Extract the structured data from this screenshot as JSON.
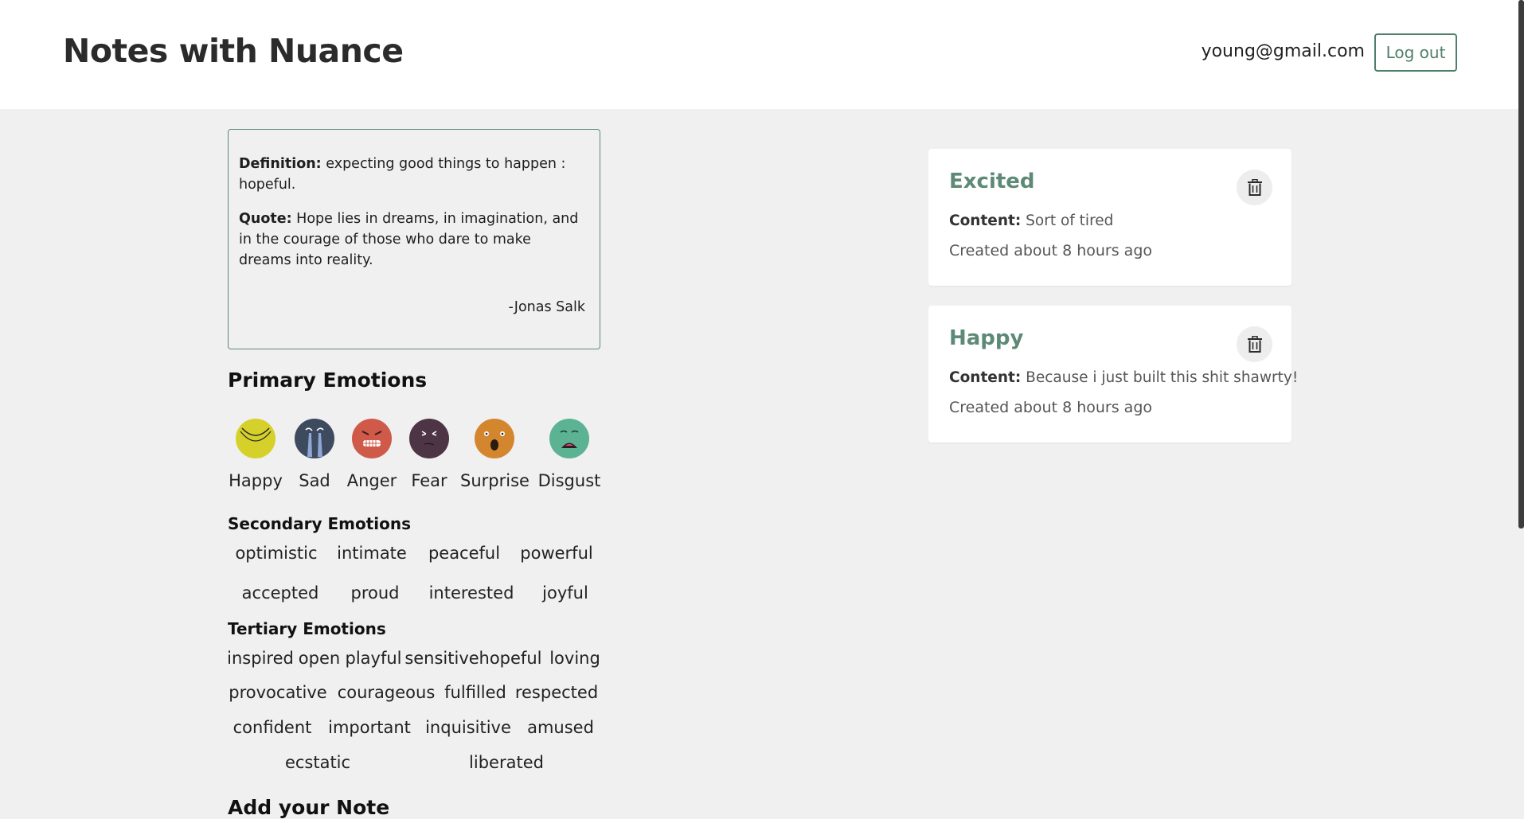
{
  "header": {
    "title": "Notes with Nuance",
    "user_email": "young@gmail.com",
    "logout_label": "Log out"
  },
  "quote_card": {
    "definition_label": "Definition:",
    "definition_text": "expecting good things to happen : hopeful.",
    "quote_label": "Quote:",
    "quote_text": "Hope lies in dreams, in imagination, and in the courage of those who dare to make dreams into reality.",
    "author": "-Jonas Salk"
  },
  "primary": {
    "title": "Primary Emotions",
    "items": [
      {
        "label": "Happy",
        "icon": "happy-face-icon",
        "color": "#d6d12a"
      },
      {
        "label": "Sad",
        "icon": "sad-face-icon",
        "color": "#3e4a5e"
      },
      {
        "label": "Anger",
        "icon": "anger-face-icon",
        "color": "#cf5a4a"
      },
      {
        "label": "Fear",
        "icon": "fear-face-icon",
        "color": "#4d3545"
      },
      {
        "label": "Surprise",
        "icon": "surprise-face-icon",
        "color": "#d4862f"
      },
      {
        "label": "Disgust",
        "icon": "disgust-face-icon",
        "color": "#5bb394"
      }
    ]
  },
  "secondary": {
    "title": "Secondary Emotions",
    "items": [
      "optimistic",
      "intimate",
      "peaceful",
      "powerful",
      "accepted",
      "proud",
      "interested",
      "joyful"
    ]
  },
  "tertiary": {
    "title": "Tertiary Emotions",
    "items": [
      "inspired",
      "open",
      "playful",
      "sensitive",
      "hopeful",
      "loving",
      "provocative",
      "courageous",
      "fulfilled",
      "respected",
      "confident",
      "important",
      "inquisitive",
      "amused",
      "ecstatic",
      "liberated"
    ]
  },
  "add_note": {
    "title": "Add your Note"
  },
  "notes": [
    {
      "title": "Excited",
      "content_label": "Content:",
      "content": "Sort of tired",
      "created": "Created about 8 hours ago"
    },
    {
      "title": "Happy",
      "content_label": "Content:",
      "content": "Because i just built this shit shawrty!",
      "created": "Created about 8 hours ago"
    }
  ],
  "colors": {
    "accent": "#5d8a76",
    "background": "#f0f0f0"
  }
}
